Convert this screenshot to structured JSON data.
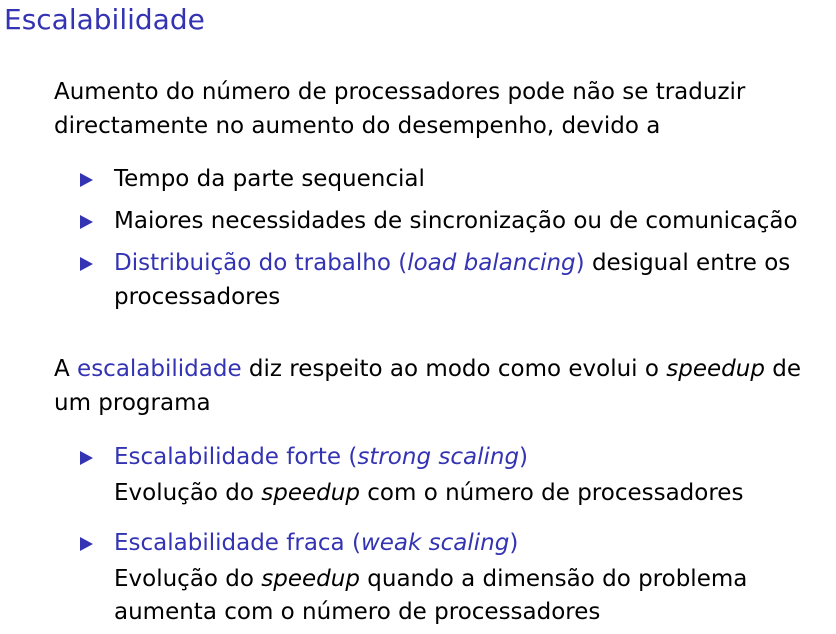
{
  "title": "Escalabilidade",
  "intro": {
    "line1": "Aumento do número de processadores pode não se traduzir",
    "line2": "directamente no aumento do desempenho, devido a"
  },
  "reasons": {
    "item1": "Tempo da parte sequencial",
    "item2": "Maiores necessidades de sincronização ou de comunicação",
    "item3": {
      "lead": "Distribuição do trabalho (",
      "term": "load balancing",
      "close": ")",
      "rest": " desigual entre os",
      "line2": "processadores"
    }
  },
  "definition": {
    "a": "A ",
    "term": "escalabilidade",
    "mid": " diz respeito ao modo como evolui o ",
    "speedup": "speedup",
    "de": " de",
    "line2": "um programa"
  },
  "scaling": {
    "strong": {
      "lead": "Escalabilidade forte (",
      "term": "strong scaling",
      "close": ")",
      "desc_a": "Evolução do ",
      "desc_speedup": "speedup",
      "desc_b": " com o número de processadores"
    },
    "weak": {
      "lead": "Escalabilidade fraca (",
      "term": "weak scaling",
      "close": ")",
      "desc_a": "Evolução do ",
      "desc_speedup": "speedup",
      "desc_b": " quando a dimensão do problema",
      "desc_line2": "aumenta com o número de processadores"
    }
  },
  "colors": {
    "accent": "#3333b3",
    "text": "#000000"
  }
}
